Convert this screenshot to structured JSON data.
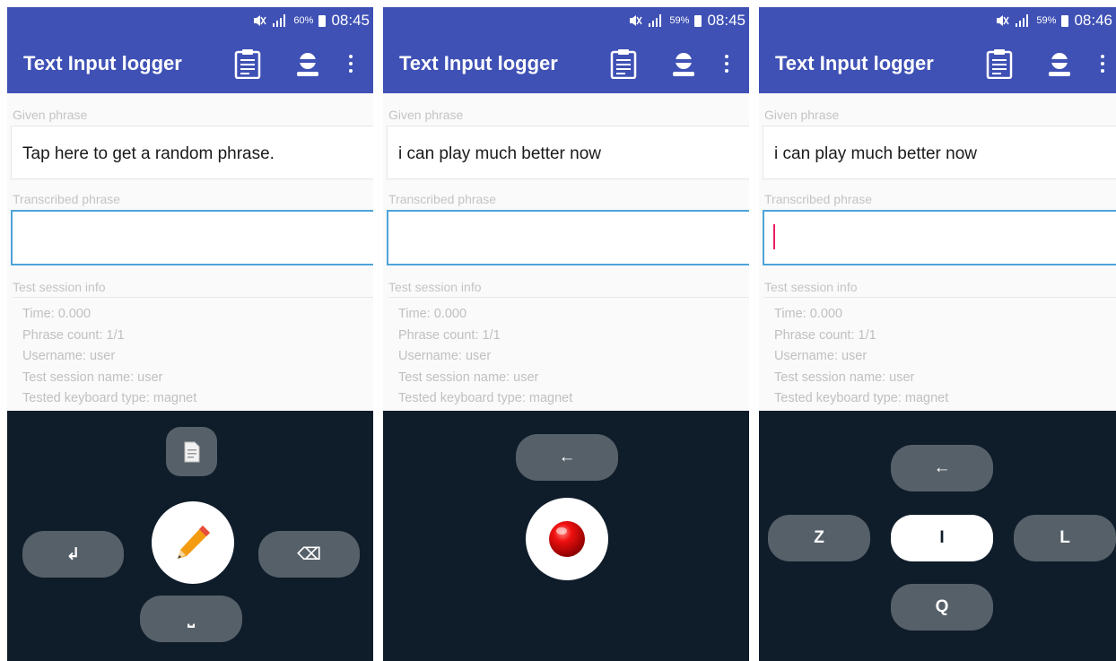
{
  "colors": {
    "primary": "#3f51b5",
    "keyboard_bg": "#0f1c2a",
    "key_bg": "#566069",
    "field_focus": "#4fa3d9",
    "caret": "#e91e63"
  },
  "screens": [
    {
      "status": {
        "battery": "60%",
        "time": "08:45"
      },
      "app_title": "Text Input logger",
      "given_label": "Given phrase",
      "given_text": "Tap here to get a random phrase.",
      "transcribed_label": "Transcribed phrase",
      "transcribed_text": "",
      "session_label": "Test session info",
      "info": [
        "Time: 0.000",
        "Phrase count: 1/1",
        "Username: user",
        "Test session name: user",
        "Tested keyboard type: magnet"
      ],
      "keyboard": {
        "enter": "↲",
        "backspace": "⌫",
        "space": "⎵",
        "center_icon": "pencil-icon",
        "top_icon": "document-icon"
      }
    },
    {
      "status": {
        "battery": "59%",
        "time": "08:45"
      },
      "app_title": "Text Input logger",
      "given_label": "Given phrase",
      "given_text": "i can play much better now",
      "transcribed_label": "Transcribed phrase",
      "transcribed_text": "",
      "session_label": "Test session info",
      "info": [
        "Time: 0.000",
        "Phrase count: 1/1",
        "Username: user",
        "Test session name: user",
        "Tested keyboard type: magnet"
      ],
      "keyboard": {
        "back": "←",
        "center_icon": "red-record-icon"
      }
    },
    {
      "status": {
        "battery": "59%",
        "time": "08:46"
      },
      "app_title": "Text Input logger",
      "given_label": "Given phrase",
      "given_text": "i can play much better now",
      "transcribed_label": "Transcribed phrase",
      "transcribed_text": "",
      "session_label": "Test session info",
      "info": [
        "Time: 0.000",
        "Phrase count: 1/1",
        "Username: user",
        "Test session name: user",
        "Tested keyboard type: magnet"
      ],
      "keyboard": {
        "back": "←",
        "left": "Z",
        "center": "I",
        "right": "L",
        "bottom": "Q"
      }
    }
  ]
}
